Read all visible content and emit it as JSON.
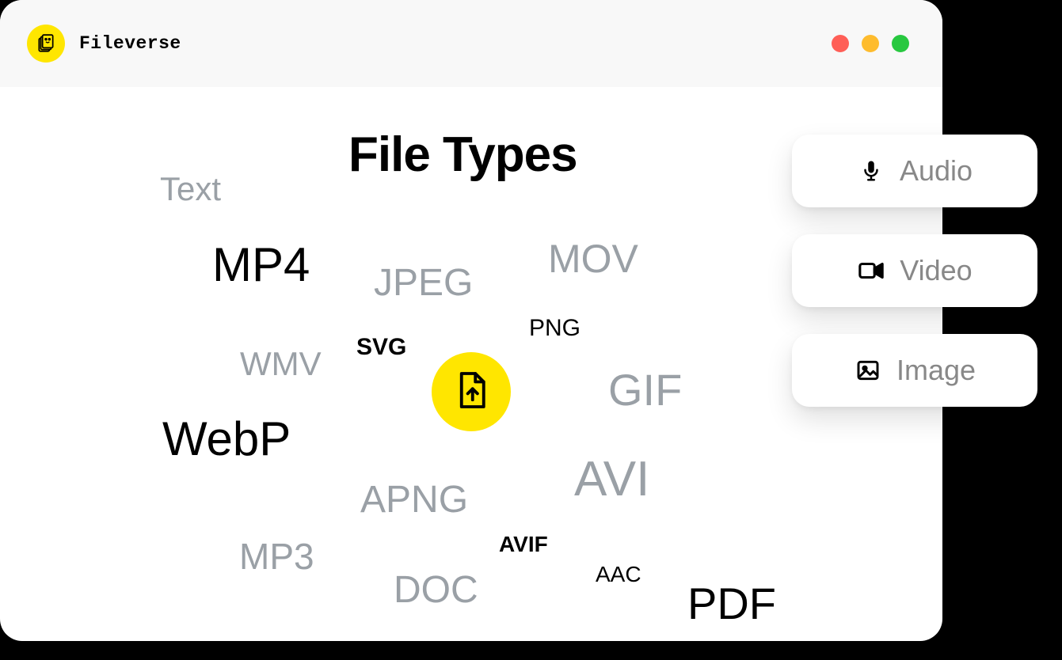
{
  "brand": {
    "name": "Fileverse"
  },
  "heading": "File Types",
  "tags": {
    "text": "Text",
    "mp4": "MP4",
    "jpeg": "JPEG",
    "mov": "MOV",
    "wmv": "WMV",
    "svg": "SVG",
    "png": "PNG",
    "gif": "GIF",
    "webp": "WebP",
    "apng": "APNG",
    "avi": "AVI",
    "mp3": "MP3",
    "avif": "AVIF",
    "doc": "DOC",
    "aac": "AAC",
    "pdf": "PDF"
  },
  "sideButtons": {
    "audio": "Audio",
    "video": "Video",
    "image": "Image"
  }
}
